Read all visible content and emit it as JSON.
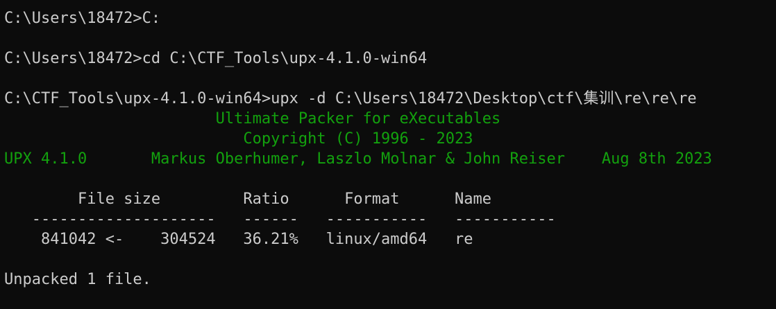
{
  "terminal": {
    "lines": [
      {
        "text": "C:\\Users\\18472>C:",
        "color": "#cccccc"
      },
      {
        "text": "",
        "color": "#cccccc"
      },
      {
        "text": "C:\\Users\\18472>cd C:\\CTF_Tools\\upx-4.1.0-win64",
        "color": "#cccccc"
      },
      {
        "text": "",
        "color": "#cccccc"
      },
      {
        "text": "C:\\CTF_Tools\\upx-4.1.0-win64>upx -d C:\\Users\\18472\\Desktop\\ctf\\集训\\re\\re\\re",
        "color": "#cccccc"
      },
      {
        "text": "                       Ultimate Packer for eXecutables",
        "color": "#13a10e"
      },
      {
        "text": "                          Copyright (C) 1996 - 2023",
        "color": "#13a10e"
      },
      {
        "text": "UPX 4.1.0       Markus Oberhumer, Laszlo Molnar & John Reiser    Aug 8th 2023",
        "color": "#13a10e"
      },
      {
        "text": "",
        "color": "#cccccc"
      },
      {
        "text": "        File size         Ratio      Format      Name",
        "color": "#cccccc"
      },
      {
        "text": "   --------------------   ------   -----------   -----------",
        "color": "#cccccc"
      },
      {
        "text": "    841042 <-    304524   36.21%   linux/amd64   re",
        "color": "#cccccc"
      },
      {
        "text": "",
        "color": "#cccccc"
      },
      {
        "text": "Unpacked 1 file.",
        "color": "#cccccc"
      }
    ]
  }
}
